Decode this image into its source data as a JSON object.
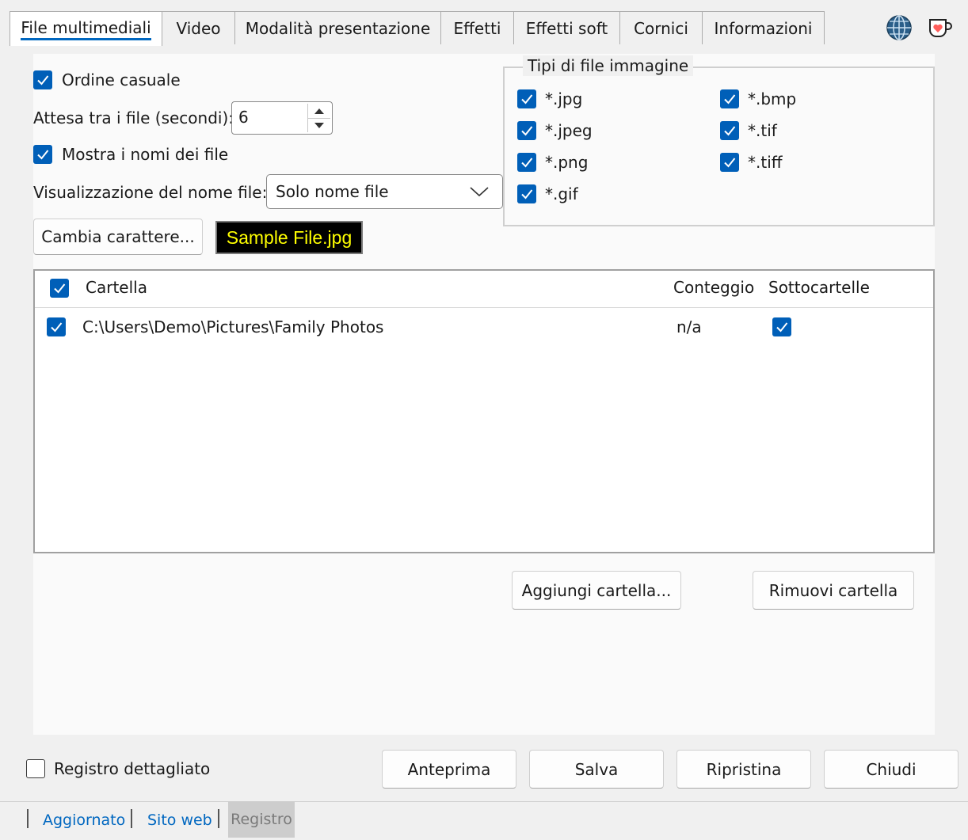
{
  "tabs": [
    {
      "label": "File multimediali",
      "active": true
    },
    {
      "label": "Video"
    },
    {
      "label": "Modalità presentazione"
    },
    {
      "label": "Effetti"
    },
    {
      "label": "Effetti soft"
    },
    {
      "label": "Cornici"
    },
    {
      "label": "Informazioni"
    }
  ],
  "top_icons": {
    "globe": "globe-icon",
    "coffee": "coffee-heart-icon"
  },
  "options": {
    "random_order": {
      "label": "Ordine casuale",
      "checked": true
    },
    "wait_label": "Attesa tra i file (secondi):",
    "wait_value": "6",
    "show_names": {
      "label": "Mostra i nomi dei file",
      "checked": true
    },
    "name_display_label": "Visualizzazione del nome file:",
    "name_display_value": "Solo nome file",
    "change_font_label": "Cambia carattere...",
    "sample_text": "Sample File.jpg"
  },
  "file_types": {
    "title": "Tipi di file immagine",
    "items": [
      {
        "label": "*.jpg",
        "checked": true
      },
      {
        "label": "*.jpeg",
        "checked": true
      },
      {
        "label": "*.png",
        "checked": true
      },
      {
        "label": "*.gif",
        "checked": true
      },
      {
        "label": "*.bmp",
        "checked": true
      },
      {
        "label": "*.tif",
        "checked": true
      },
      {
        "label": "*.tiff",
        "checked": true
      }
    ]
  },
  "folders": {
    "columns": [
      "Cartella",
      "Conteggio",
      "Sottocartelle"
    ],
    "rows": [
      {
        "path": "C:\\Users\\Demo\\Pictures\\Family Photos",
        "count": "n/a",
        "subfolders": true,
        "checked": true
      }
    ],
    "add_label": "Aggiungi cartella...",
    "remove_label": "Rimuovi cartella"
  },
  "bottom": {
    "verbose_log": {
      "label": "Registro dettagliato",
      "checked": false
    },
    "preview": "Anteprima",
    "save": "Salva",
    "reset": "Ripristina",
    "close": "Chiudi"
  },
  "footer": {
    "updated": "Aggiornato",
    "website": "Sito web",
    "log": "Registro"
  },
  "colors": {
    "accent": "#005fb8",
    "link": "#0067c0",
    "sample_bg": "#000000",
    "sample_fg": "#ffff00"
  }
}
